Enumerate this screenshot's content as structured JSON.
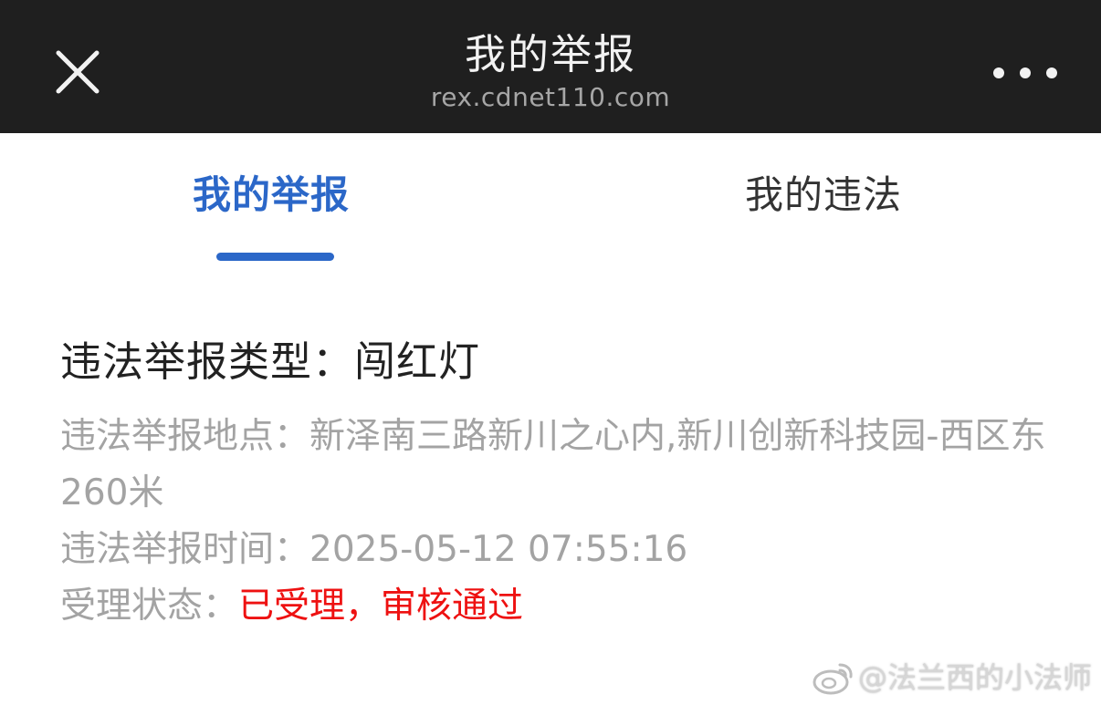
{
  "header": {
    "title": "我的举报",
    "url": "rex.cdnet110.com"
  },
  "tabs": [
    {
      "label": "我的举报",
      "active": true
    },
    {
      "label": "我的违法",
      "active": false
    }
  ],
  "report": {
    "type_label": "违法举报类型：",
    "type_value": "闯红灯",
    "location_label": "违法举报地点：",
    "location_value": "新泽南三路新川之心内,新川创新科技园-西区东260米",
    "time_label": "违法举报时间：",
    "time_value": "2025-05-12 07:55:16",
    "status_label": "受理状态：",
    "status_value": "已受理，审核通过"
  },
  "watermark": {
    "text": "@法兰西的小法师"
  },
  "colors": {
    "header_bg": "#1f1f1f",
    "accent": "#2b67c8",
    "status": "#ee1111",
    "muted_text": "#a3a3a3"
  },
  "icons": {
    "close": "close-icon",
    "more": "more-dots-icon",
    "watermark": "weibo-icon"
  }
}
